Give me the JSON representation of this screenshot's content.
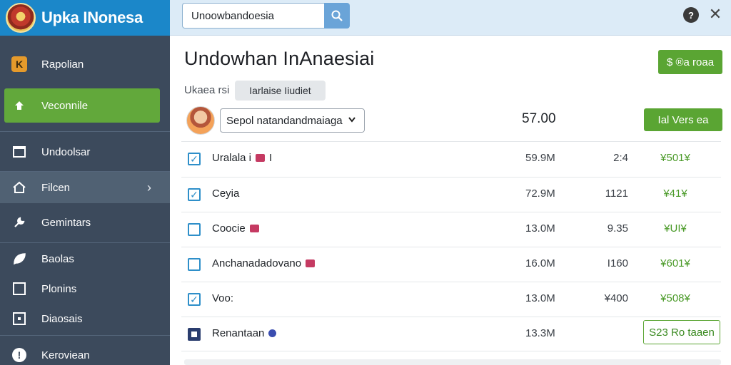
{
  "app": {
    "title": "Upka INonesa"
  },
  "sidebar": {
    "items": [
      {
        "label": "Rapolian",
        "icon": "k-badge-icon"
      },
      {
        "label": "Veconnile",
        "icon": "upload-icon",
        "active": true
      },
      {
        "label": "Undoolsar",
        "icon": "document-icon"
      },
      {
        "label": "Filcen",
        "icon": "home-icon",
        "chevron": "›"
      },
      {
        "label": "Gemintars",
        "icon": "wrench-icon"
      },
      {
        "label": "Baolas",
        "icon": "leaf-icon"
      },
      {
        "label": "Plonins",
        "icon": "square-icon"
      },
      {
        "label": "Diaosais",
        "icon": "square-dot-icon"
      },
      {
        "label": "Keroviean",
        "icon": "info-icon"
      }
    ]
  },
  "header": {
    "search": {
      "value": "Unoowbandoesia",
      "placeholder": ""
    },
    "help": "?",
    "close": "✕"
  },
  "main": {
    "title": "Undowhan InAnaesiai",
    "top_button": "$ ®a roaa",
    "meta": {
      "label": "Ukaea rsi",
      "tag": "Iarlaise Iiudiet"
    },
    "select_value": "Sepol natandandmaiaga",
    "amount": "57.00",
    "action_button": "Ial Vers ea",
    "rows": [
      {
        "name": "Uralala i",
        "suffix": "I",
        "badge": "red",
        "size": "59.9M",
        "count": "2:4",
        "price": "¥501¥",
        "checked": true
      },
      {
        "name": "Ceyia",
        "suffix": "",
        "badge": "",
        "size": "72.9M",
        "count": "1121",
        "price": "¥41¥",
        "checked": true
      },
      {
        "name": "Coocie",
        "suffix": "",
        "badge": "red",
        "size": "13.0M",
        "count": "9.35",
        "price": "¥UI¥",
        "checked": false
      },
      {
        "name": "Anchanadadovano",
        "suffix": "",
        "badge": "red",
        "size": "16.0M",
        "count": " I160",
        "price": "¥601¥",
        "checked": false
      },
      {
        "name": "Voo:",
        "suffix": "",
        "badge": "",
        "size": "13.0M",
        "count": "¥400",
        "price": "¥508¥",
        "checked": true
      },
      {
        "name": "Renantaan",
        "suffix": "",
        "badge": "blue",
        "size": "13.3M",
        "count": "",
        "price": "",
        "checked": "dark"
      }
    ],
    "row_button": "S23 Ro taaen"
  },
  "colors": {
    "sidebar_bg": "#3c4a5c",
    "brand_bg": "#1b87c9",
    "accent_green": "#5aa533",
    "topbar_bg": "#dcebf7",
    "checkbox_blue": "#2e8fc9"
  }
}
